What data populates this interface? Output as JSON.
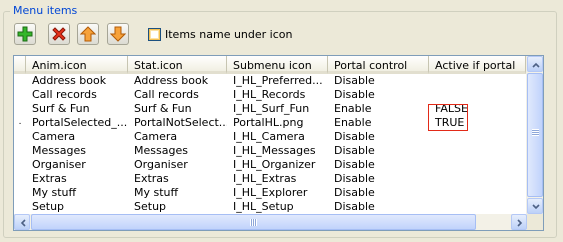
{
  "group": {
    "title": "Menu items"
  },
  "toolbar": {
    "add_icon": "plus-icon",
    "delete_icon": "red-x-icon",
    "up_icon": "orange-up-arrow-icon",
    "down_icon": "orange-down-arrow-icon"
  },
  "options": {
    "items_name_under_icon": {
      "label": "Items name under icon",
      "checked": false
    }
  },
  "table": {
    "columns": [
      "Anim.icon",
      "Stat.icon",
      "Submenu icon",
      "Portal control",
      "Active if portal"
    ],
    "rows": [
      {
        "indicator": "",
        "anim": "Address book",
        "stat": "Address book",
        "submenu": "I_HL_Preferred...",
        "portal": "Disable",
        "active": ""
      },
      {
        "indicator": "",
        "anim": "Call records",
        "stat": "Call records",
        "submenu": "I_HL_Records",
        "portal": "Disable",
        "active": ""
      },
      {
        "indicator": "",
        "anim": "Surf & Fun",
        "stat": "Surf & Fun",
        "submenu": "I_HL_Surf_Fun",
        "portal": "Enable",
        "active": "FALSE"
      },
      {
        "indicator": ".",
        "anim": "PortalSelected_...",
        "stat": "PortalNotSelect...",
        "submenu": "PortalHL.png",
        "portal": "Enable",
        "active": "TRUE"
      },
      {
        "indicator": "",
        "anim": "Camera",
        "stat": "Camera",
        "submenu": "I_HL_Camera",
        "portal": "Disable",
        "active": ""
      },
      {
        "indicator": "",
        "anim": "Messages",
        "stat": "Messages",
        "submenu": "I_HL_Messages",
        "portal": "Disable",
        "active": ""
      },
      {
        "indicator": "",
        "anim": "Organiser",
        "stat": "Organiser",
        "submenu": "I_HL_Organizer",
        "portal": "Disable",
        "active": ""
      },
      {
        "indicator": "",
        "anim": "Extras",
        "stat": "Extras",
        "submenu": "I_HL_Extras",
        "portal": "Disable",
        "active": ""
      },
      {
        "indicator": "",
        "anim": "My stuff",
        "stat": "My stuff",
        "submenu": "I_HL_Explorer",
        "portal": "Disable",
        "active": ""
      },
      {
        "indicator": "",
        "anim": "Setup",
        "stat": "Setup",
        "submenu": "I_HL_Setup",
        "portal": "Disable",
        "active": ""
      }
    ]
  },
  "colors": {
    "legend_blue": "#0046d5",
    "highlight_box": "#e22a18"
  }
}
